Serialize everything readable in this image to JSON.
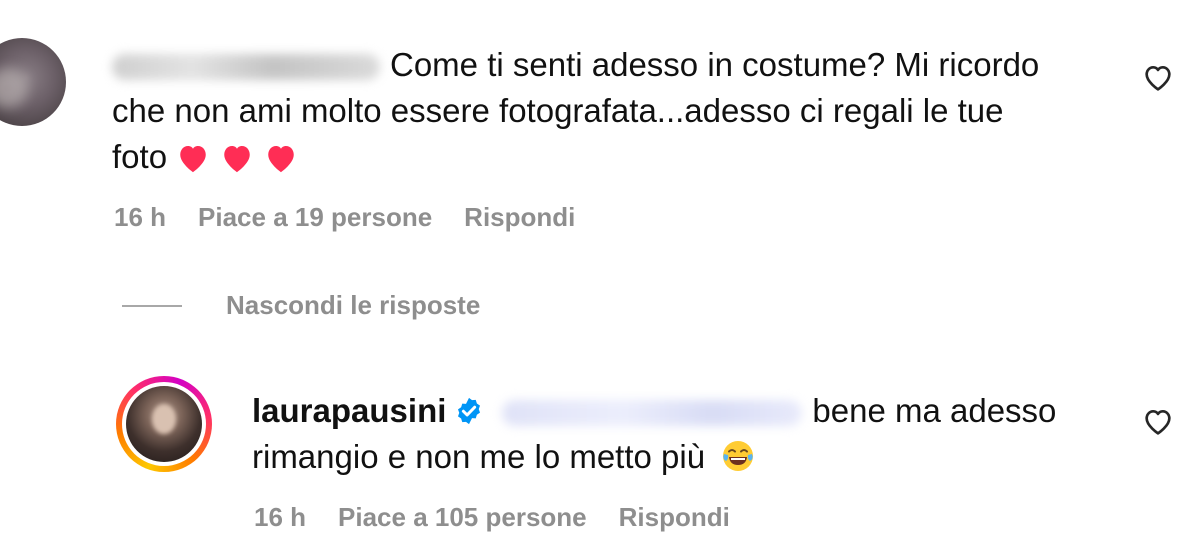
{
  "comment": {
    "text_line1": "Come ti senti adesso in costume? Mi ricordo",
    "text_line2": "che non ami molto essere fotografata...adesso ci regali le tue",
    "text_line3": "foto",
    "emojis": [
      "heart-icon",
      "heart-icon",
      "heart-icon"
    ],
    "time": "16 h",
    "likes": "Piace a 19 persone",
    "reply_label": "Rispondi"
  },
  "hide_replies": {
    "label": "Nascondi le risposte"
  },
  "reply": {
    "username": "laurapausini",
    "verified": true,
    "text_line1": "bene ma adesso",
    "text_line2": "rimangio e non me lo metto più",
    "emoji": "tears-of-joy-icon",
    "time": "16 h",
    "likes": "Piace a 105 persone",
    "reply_label": "Rispondi"
  },
  "colors": {
    "text": "#111111",
    "meta": "#8e8e8e",
    "heart": "#ff2d55",
    "verified": "#0095f6"
  }
}
